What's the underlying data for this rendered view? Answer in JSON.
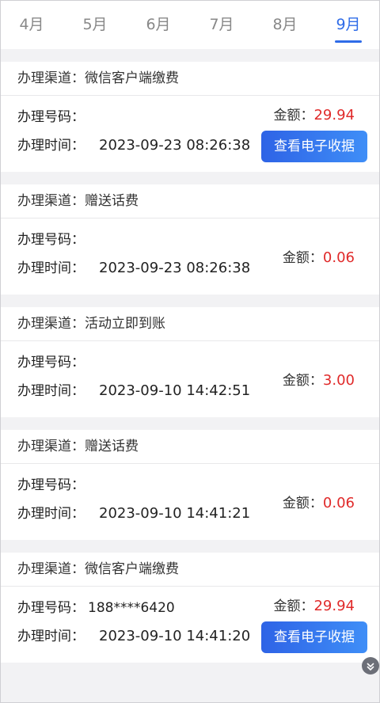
{
  "tabs": [
    {
      "label": "4月",
      "active": false
    },
    {
      "label": "5月",
      "active": false
    },
    {
      "label": "6月",
      "active": false
    },
    {
      "label": "7月",
      "active": false
    },
    {
      "label": "8月",
      "active": false
    },
    {
      "label": "9月",
      "active": true
    }
  ],
  "labels": {
    "channel": "办理渠道：",
    "number": "办理号码：",
    "time": "办理时间：",
    "amount": "金额：",
    "receipt": "查看电子收据"
  },
  "records": [
    {
      "channel": "微信客户端缴费",
      "number": "",
      "time": "2023-09-23 08:26:38",
      "amount": "29.94",
      "has_receipt": true
    },
    {
      "channel": "赠送话费",
      "number": "",
      "time": "2023-09-23 08:26:38",
      "amount": "0.06",
      "has_receipt": false
    },
    {
      "channel": "活动立即到账",
      "number": "",
      "time": "2023-09-10 14:42:51",
      "amount": "3.00",
      "has_receipt": false
    },
    {
      "channel": "赠送话费",
      "number": "",
      "time": "2023-09-10 14:41:21",
      "amount": "0.06",
      "has_receipt": false
    },
    {
      "channel": "微信客户端缴费",
      "number": "188****6420",
      "time": "2023-09-10 14:41:20",
      "amount": "29.94",
      "has_receipt": true
    }
  ],
  "colors": {
    "accent": "#2f6ce8",
    "amount": "#e02a2a"
  },
  "icons": {
    "scroll": "chevron-double-down-icon"
  }
}
